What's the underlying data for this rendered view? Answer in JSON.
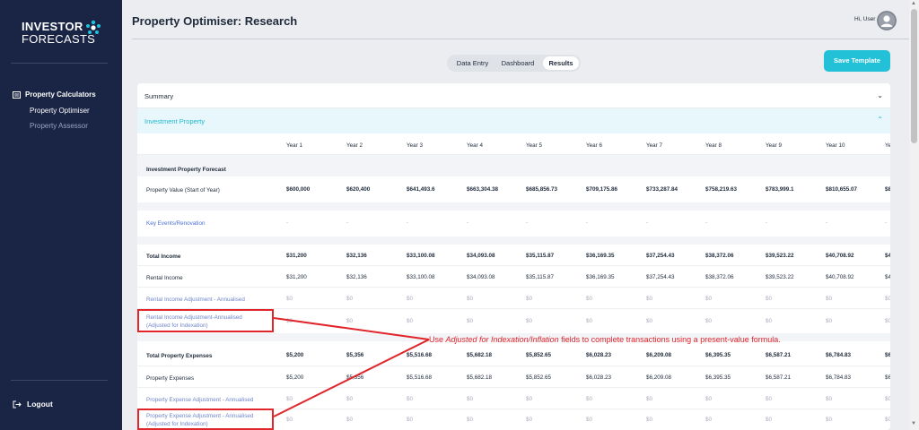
{
  "sidebar": {
    "logo_line1": "INVESTOR",
    "logo_line2": "FORECASTS",
    "group_label": "Property Calculators",
    "items": [
      {
        "label": "Property Optimiser"
      },
      {
        "label": "Property Assessor"
      }
    ],
    "logout_label": "Logout"
  },
  "header": {
    "title": "Property Optimiser: Research",
    "greeting": "Hi, User"
  },
  "tabs": [
    {
      "label": "Data Entry"
    },
    {
      "label": "Dashboard"
    },
    {
      "label": "Results"
    }
  ],
  "save_button": "Save Template",
  "summary_label": "Summary",
  "section_label": "Investment Property",
  "columns": [
    "Year 1",
    "Year 2",
    "Year 3",
    "Year 4",
    "Year 5",
    "Year 6",
    "Year 7",
    "Year 8",
    "Year 9",
    "Year 10",
    "Ye"
  ],
  "rows": [
    {
      "label": "Investment Property Forecast",
      "style": "bold",
      "values": []
    },
    {
      "label": "Property Value (Start of Year)",
      "style": "normal",
      "values": [
        "$600,000",
        "$620,400",
        "$641,493.6",
        "$663,304.38",
        "$685,856.73",
        "$709,175.86",
        "$733,287.84",
        "$758,219.63",
        "$783,999.1",
        "$810,655.07",
        "$8"
      ]
    },
    {
      "label": "Key Events/Renovation",
      "style": "link",
      "values": [
        "-",
        "-",
        "-",
        "-",
        "-",
        "-",
        "-",
        "-",
        "-",
        "-",
        "-"
      ]
    },
    {
      "label": "Total Income",
      "style": "bold",
      "values": [
        "$31,200",
        "$32,136",
        "$33,100.08",
        "$34,093.08",
        "$35,115.87",
        "$36,169.35",
        "$37,254.43",
        "$38,372.06",
        "$39,523.22",
        "$40,708.92",
        "$4"
      ]
    },
    {
      "label": "Rental Income",
      "style": "normal",
      "values": [
        "$31,200",
        "$32,136",
        "$33,100.08",
        "$34,093.08",
        "$35,115.87",
        "$36,169.35",
        "$37,254.43",
        "$38,372.06",
        "$39,523.22",
        "$40,708.92",
        "$4"
      ]
    },
    {
      "label": "Rental Income Adjustment - Annualised",
      "style": "muted",
      "values": [
        "$0",
        "$0",
        "$0",
        "$0",
        "$0",
        "$0",
        "$0",
        "$0",
        "$0",
        "$0",
        "$0"
      ]
    },
    {
      "label_line1": "Rental Income Adjustment-Annualised",
      "label_line2": "(Adjusted for Indexation)",
      "style": "muted",
      "values": [
        "$0",
        "$0",
        "$0",
        "$0",
        "$0",
        "$0",
        "$0",
        "$0",
        "$0",
        "$0",
        "$0"
      ]
    },
    {
      "label": "Total Property Expenses",
      "style": "bold",
      "values": [
        "$5,200",
        "$5,356",
        "$5,516.68",
        "$5,682.18",
        "$5,852.65",
        "$6,028.23",
        "$6,209.08",
        "$6,395.35",
        "$6,587.21",
        "$6,784.83",
        "$6"
      ]
    },
    {
      "label": "Property Expenses",
      "style": "normal",
      "values": [
        "$5,200",
        "$5,356",
        "$5,516.68",
        "$5,682.18",
        "$5,852.65",
        "$6,028.23",
        "$6,209.08",
        "$6,395.35",
        "$6,587.21",
        "$6,784.83",
        "$6"
      ]
    },
    {
      "label": "Property Expense Adjustment - Annualised",
      "style": "muted",
      "values": [
        "$0",
        "$0",
        "$0",
        "$0",
        "$0",
        "$0",
        "$0",
        "$0",
        "$0",
        "$0",
        "$0"
      ]
    },
    {
      "label_line1": "Property Expense Adjustment - Annualised",
      "label_line2": "(Adjusted for Indexation)",
      "style": "muted",
      "values": [
        "$0",
        "$0",
        "$0",
        "$0",
        "$0",
        "$0",
        "$0",
        "$0",
        "$0",
        "$0",
        "$0"
      ]
    }
  ],
  "annotation": {
    "prefix": "Use ",
    "emphasis": "Adjusted for Indexation/Inflation",
    "suffix": " fields to complete transactions using a present-value formula."
  },
  "colors": {
    "sidebar_bg": "#1a2546",
    "accent": "#22c1d7",
    "annotation_red": "#e0252b",
    "link_blue": "#4a6fd6"
  },
  "icons": [
    "logo-mark-icon",
    "calculator-icon",
    "logout-icon",
    "avatar-icon",
    "chevron-down-icon",
    "chevron-up-icon"
  ]
}
